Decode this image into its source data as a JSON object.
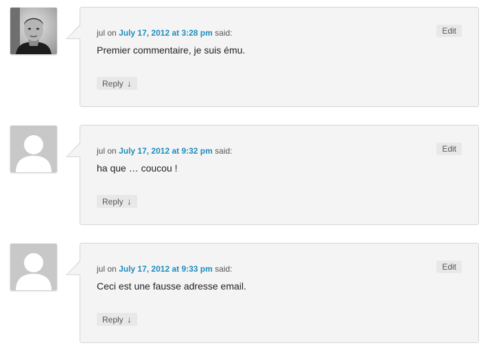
{
  "comments": [
    {
      "author": "jul",
      "on_text": "on",
      "date": "July 17, 2012 at 3:28 pm",
      "said_text": "said:",
      "text": "Premier commentaire, je suis ému.",
      "edit_label": "Edit",
      "reply_label": "Reply",
      "reply_arrow": "↓",
      "avatar": "photo-avatar"
    },
    {
      "author": "jul",
      "on_text": "on",
      "date": "July 17, 2012 at 9:32 pm",
      "said_text": "said:",
      "text": "ha que … coucou !",
      "edit_label": "Edit",
      "reply_label": "Reply",
      "reply_arrow": "↓",
      "avatar": "default-avatar"
    },
    {
      "author": "jul",
      "on_text": "on",
      "date": "July 17, 2012 at 9:33 pm",
      "said_text": "said:",
      "text": "Ceci est une fausse adresse email.",
      "edit_label": "Edit",
      "reply_label": "Reply",
      "reply_arrow": "↓",
      "avatar": "default-avatar"
    }
  ],
  "colors": {
    "link": "#1e8cbe",
    "bubble_bg": "#f4f4f4",
    "bubble_border": "#d6d6d6",
    "button_bg": "#e8e8e8",
    "avatar_default_bg": "#c8c8c8"
  }
}
